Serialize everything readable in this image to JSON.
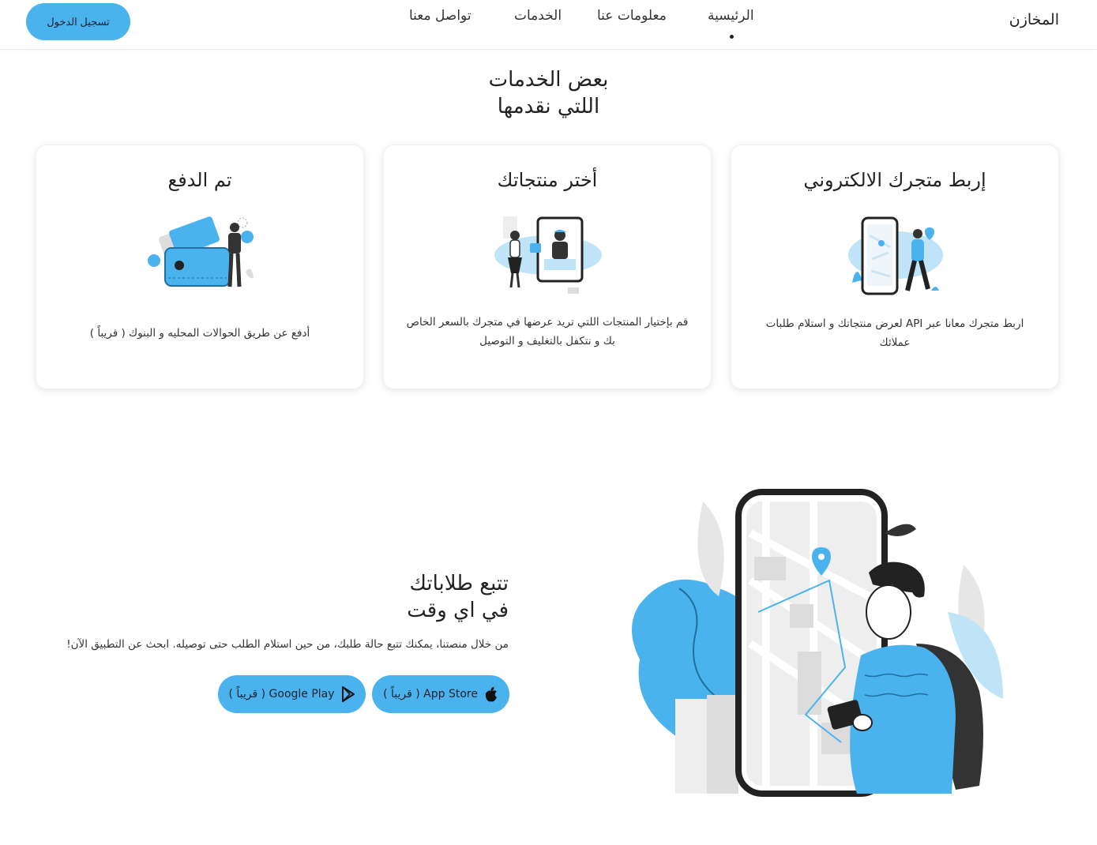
{
  "header": {
    "brand": "المخازن",
    "nav": [
      "الرئيسية",
      "معلومات عنا",
      "الخدمات",
      "تواصل معنا"
    ],
    "login_label": "تسجيل الدخول"
  },
  "services": {
    "title_line1": "بعض الخدمات",
    "title_line2": "اللتي نقدمها",
    "cards": [
      {
        "title": "إربط متجرك الالكتروني",
        "desc": "اربط متجرك معانا عبر API لعرض منتجاتك و استلام طلبات عملائك",
        "icon": "store-connect-illustration"
      },
      {
        "title": "أختر منتجاتك",
        "desc": "قم بإختيار المنتجات اللتي تريد عرضها في متجرك بالسعر الخاص بك و نتكفل بالتغليف و التوصيل",
        "icon": "choose-products-illustration"
      },
      {
        "title": "تم الدفع",
        "desc": "أدفع عن طريق الحوالات المحليه و البنوك ( قريباً )",
        "icon": "payment-wallet-illustration"
      }
    ]
  },
  "tracking": {
    "title_line1": "تتبع طلاباتك",
    "title_line2": "في اي وقت",
    "desc": "من خلال منصتنا، يمكنك تتبع حالة طلبك، من حين استلام الطلب حتى توصيله. ابحث عن التطبيق الآن!",
    "appstore_label": "App Store ( قريباً )",
    "gplay_label": "Google Play ( قريباً )",
    "illustration": "phone-map-tracking-illustration"
  },
  "colors": {
    "accent": "#4ab3ee",
    "light_blue": "#bfe3f7",
    "text": "#222222"
  }
}
